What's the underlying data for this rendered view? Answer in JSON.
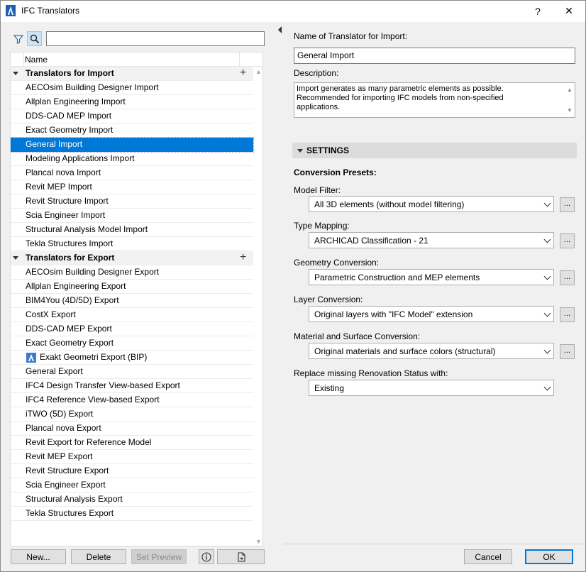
{
  "window": {
    "title": "IFC Translators",
    "help_label": "?",
    "close_label": "✕",
    "brand_color": "#0078d7"
  },
  "left": {
    "filter_icon": "filter-icon",
    "search_icon": "search-icon",
    "search_value": "",
    "column_name": "Name",
    "groups": [
      {
        "label": "Translators for Import",
        "items": [
          "AECOsim Building Designer Import",
          "Allplan Engineering Import",
          "DDS-CAD MEP Import",
          "Exact Geometry Import",
          "General Import",
          "Modeling Applications Import",
          "Plancal nova Import",
          "Revit MEP Import",
          "Revit Structure Import",
          "Scia Engineer Import",
          "Structural Analysis Model Import",
          "Tekla Structures Import"
        ]
      },
      {
        "label": "Translators for Export",
        "items": [
          "AECOsim Building Designer Export",
          "Allplan Engineering Export",
          "BIM4You (4D/5D) Export",
          "CostX Export",
          "DDS-CAD MEP Export",
          "Exact Geometry Export",
          "Exakt Geometri Export (BIP)",
          "General Export",
          "IFC4 Design Transfer View-based Export",
          "IFC4 Reference View-based Export",
          "iTWO (5D) Export",
          "Plancal nova Export",
          "Revit Export for Reference Model",
          "Revit MEP Export",
          "Revit Structure Export",
          "Scia Engineer Export",
          "Structural Analysis Export",
          "Tekla Structures Export"
        ]
      }
    ],
    "selected_item": "General Import",
    "buttons": {
      "new": "New...",
      "delete": "Delete",
      "set_preview": "Set Preview"
    }
  },
  "right": {
    "name_label": "Name of Translator for Import:",
    "name_value": "General Import",
    "description_label": "Description:",
    "description_lines": [
      "Import generates as many parametric elements as possible.",
      "Recommended for importing IFC models from non-specified",
      "applications."
    ],
    "settings_header": "SETTINGS",
    "presets_label": "Conversion Presets:",
    "fields": [
      {
        "label": "Model Filter:",
        "value": "All 3D elements (without model filtering)",
        "has_more": true
      },
      {
        "label": "Type Mapping:",
        "value": "ARCHICAD Classification - 21",
        "has_more": true
      },
      {
        "label": "Geometry Conversion:",
        "value": "Parametric Construction and MEP elements",
        "has_more": true
      },
      {
        "label": "Layer Conversion:",
        "value": "Original layers with \"IFC Model\" extension",
        "has_more": true
      },
      {
        "label": "Material and Surface Conversion:",
        "value": "Original materials and surface colors (structural)",
        "has_more": true
      },
      {
        "label": "Replace missing Renovation Status with:",
        "value": "Existing",
        "has_more": false
      }
    ],
    "more_label": "...",
    "cancel": "Cancel",
    "ok": "OK"
  }
}
